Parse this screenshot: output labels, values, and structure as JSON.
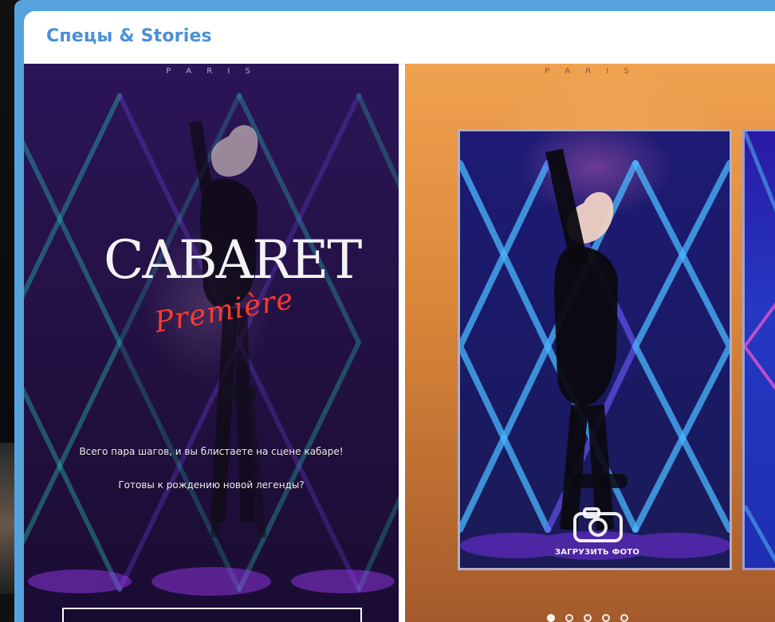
{
  "header": {
    "title": "Спецы & Stories"
  },
  "left_card": {
    "brand": "P A R I S",
    "logo_main": "CABARET",
    "logo_script": "Première",
    "text_1": "Всего пара шагов, и вы блистаете на сцене кабаре!",
    "text_2": "Готовы к рождению новой легенды?"
  },
  "right_card": {
    "brand": "P A R I S",
    "upload_label": "ЗАГРУЗИТЬ ФОТО",
    "carousel": {
      "count": 5,
      "active_index": 0
    }
  },
  "icons": {
    "camera": "camera-icon"
  },
  "colors": {
    "frame_blue": "#56a2dd",
    "title_blue": "#4a90d6",
    "neon_pink": "#ff3a2d"
  }
}
